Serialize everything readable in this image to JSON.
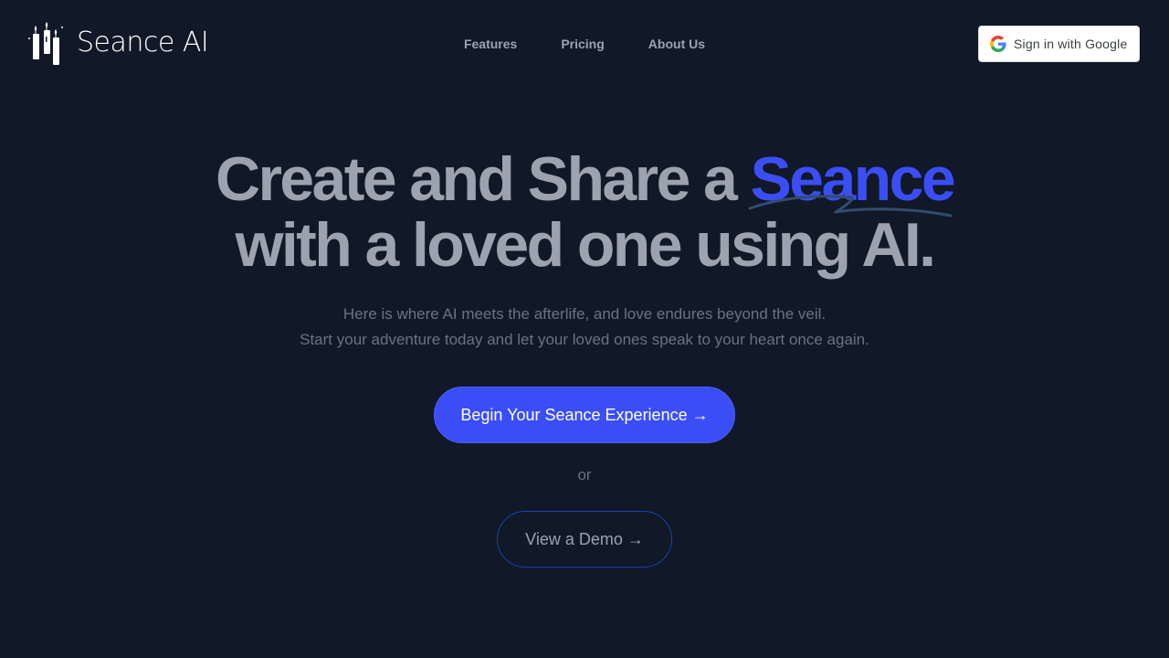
{
  "header": {
    "brand": "Seance AI",
    "logo_icon": "candles-icon",
    "nav": [
      {
        "label": "Features"
      },
      {
        "label": "Pricing"
      },
      {
        "label": "About Us"
      }
    ],
    "signin": {
      "label": "Sign in with Google",
      "icon": "google-icon"
    }
  },
  "hero": {
    "title_line1_prefix": "Create and Share a ",
    "title_accent": "Seance",
    "title_line2": "with a loved one using AI.",
    "subtitle_line1": "Here is where AI meets the afterlife, and love endures beyond the veil.",
    "subtitle_line2": "Start your adventure today and let your loved ones speak to your heart once again.",
    "primary_cta": "Begin Your Seance Experience →",
    "or_text": "or",
    "secondary_cta": "View a Demo →"
  },
  "colors": {
    "background": "#111827",
    "accent": "#3b4ef5",
    "muted_text": "#9ca3af",
    "subtle_text": "#6b7280",
    "outline": "#1e40af"
  }
}
